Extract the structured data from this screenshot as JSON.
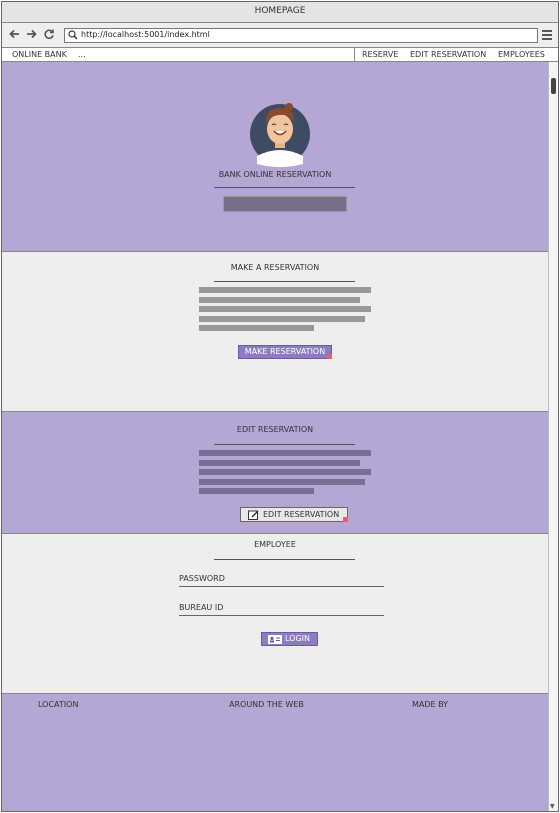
{
  "window": {
    "title": "HOMEPAGE"
  },
  "browser": {
    "url": "http://localhost:5001/index.html",
    "back_icon": "arrow-left-icon",
    "forward_icon": "arrow-right-icon",
    "reload_icon": "reload-icon",
    "menu_icon": "hamburger-icon"
  },
  "navbar": {
    "brand": "ONLINE BANK",
    "overflow": "...",
    "items": [
      {
        "label": "RESERVE"
      },
      {
        "label": "EDIT RESERVATION"
      },
      {
        "label": "EMPLOYEES"
      }
    ]
  },
  "hero": {
    "avatar_icon": "avatar-icon",
    "title": "BANK ONLINE RESERVATION"
  },
  "reserve_section": {
    "title": "MAKE A RESERVATION",
    "button_label": "MAKE RESERVATION"
  },
  "edit_section": {
    "title": "EDIT RESERVATION",
    "button_label": "EDIT RESERVATION",
    "button_icon": "edit-icon"
  },
  "employee_section": {
    "title": "EMPLOYEE",
    "password_label": "PASSWORD",
    "bureau_label": "BUREAU ID",
    "login_label": "LOGIN",
    "login_icon": "id-card-icon"
  },
  "footer": {
    "columns": [
      {
        "label": "LOCATION"
      },
      {
        "label": "AROUND THE WEB"
      },
      {
        "label": "MADE BY"
      }
    ]
  },
  "colors": {
    "purple_bg": "#b4a7d6",
    "button_purple": "#8e7cc3",
    "light_bg": "#eeeeee"
  }
}
